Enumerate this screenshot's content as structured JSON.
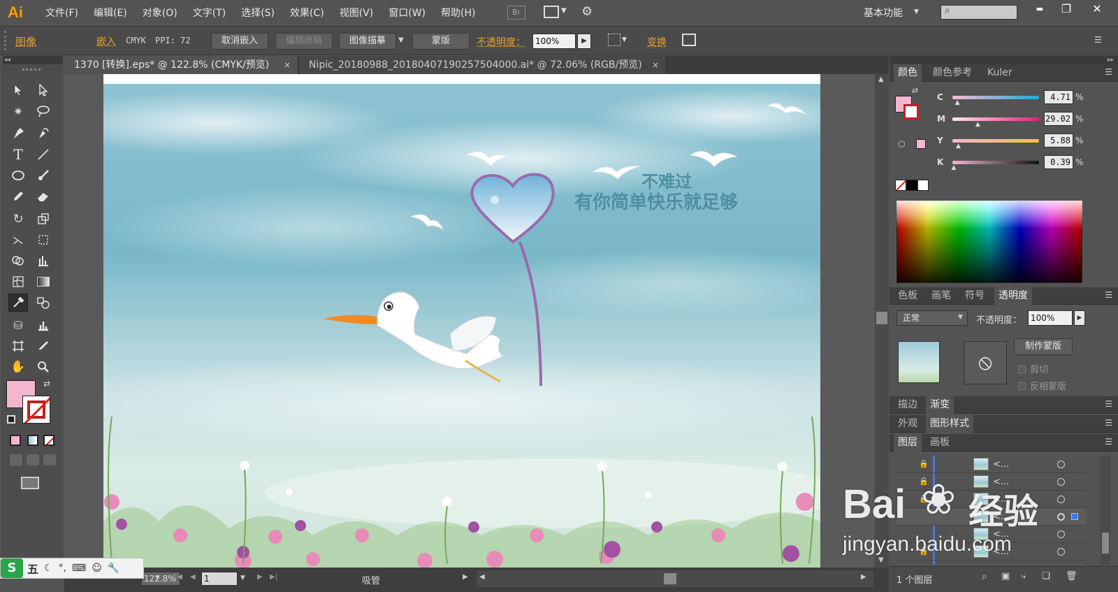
{
  "app": {
    "logo": "Ai",
    "bridge": "Br"
  },
  "menu": [
    "文件(F)",
    "编辑(E)",
    "对象(O)",
    "文字(T)",
    "选择(S)",
    "效果(C)",
    "视图(V)",
    "窗口(W)",
    "帮助(H)"
  ],
  "workspace": {
    "label": "基本功能",
    "search_placeholder": ""
  },
  "window_controls": {
    "minimize": "▬",
    "restore": "❐",
    "close": "✕"
  },
  "control": {
    "image_label": "图像",
    "embed_label": "嵌入",
    "colormode": "CMYK",
    "ppi": "PPI: 72",
    "unembed": "取消嵌入",
    "edit_original": "编辑原稿",
    "image_trace": "图像描摹",
    "mask": "蒙版",
    "opacity_label": "不透明度：",
    "opacity_value": "100%",
    "transform": "变换"
  },
  "tabs": [
    {
      "label": "1370 [转换].eps* @ 122.8% (CMYK/预览)",
      "close": "×",
      "active": true
    },
    {
      "label": "Nipic_20180988_20180407190257504000.ai* @ 72.06% (RGB/预览)",
      "close": "×",
      "active": false
    }
  ],
  "artwork": {
    "line1": "不难过",
    "line2": "有你简单快乐就足够"
  },
  "color_panel": {
    "tabs": [
      "颜色",
      "颜色参考",
      "Kuler"
    ],
    "sliders": [
      {
        "label": "C",
        "value": "4.71",
        "unit": "%",
        "level": 0.0471
      },
      {
        "label": "M",
        "value": "29.02",
        "unit": "%",
        "level": 0.2902
      },
      {
        "label": "Y",
        "value": "5.88",
        "unit": "%",
        "level": 0.0588
      },
      {
        "label": "K",
        "value": "0.39",
        "unit": "%",
        "level": 0.0039
      }
    ],
    "fill_color": "#f4b6cf"
  },
  "transparency_panel": {
    "tabs": [
      "色板",
      "画笔",
      "符号",
      "透明度"
    ],
    "blend_mode": "正常",
    "opacity_label": "不透明度：",
    "opacity_value": "100%",
    "make_mask": "制作蒙版",
    "clip": "剪切",
    "invert": "反相蒙版"
  },
  "stroke_gradient_tabs": [
    "描边",
    "渐变"
  ],
  "appearance_tabs": [
    "外观",
    "图形样式"
  ],
  "layers_panel": {
    "tabs": [
      "图层",
      "画板"
    ],
    "rows": [
      {
        "name": "<..."
      },
      {
        "name": "<..."
      },
      {
        "name": "<..."
      },
      {
        "name": "<..."
      },
      {
        "name": "<..."
      },
      {
        "name": "<..."
      }
    ],
    "footer": "1 个图层"
  },
  "status": {
    "zoom": "122.8%",
    "page": "1",
    "tool": "吸管"
  },
  "watermark": {
    "brand": "Bai",
    "brand2": "经验",
    "url": "jingyan.baidu.com"
  },
  "ime": {
    "label": "五"
  }
}
